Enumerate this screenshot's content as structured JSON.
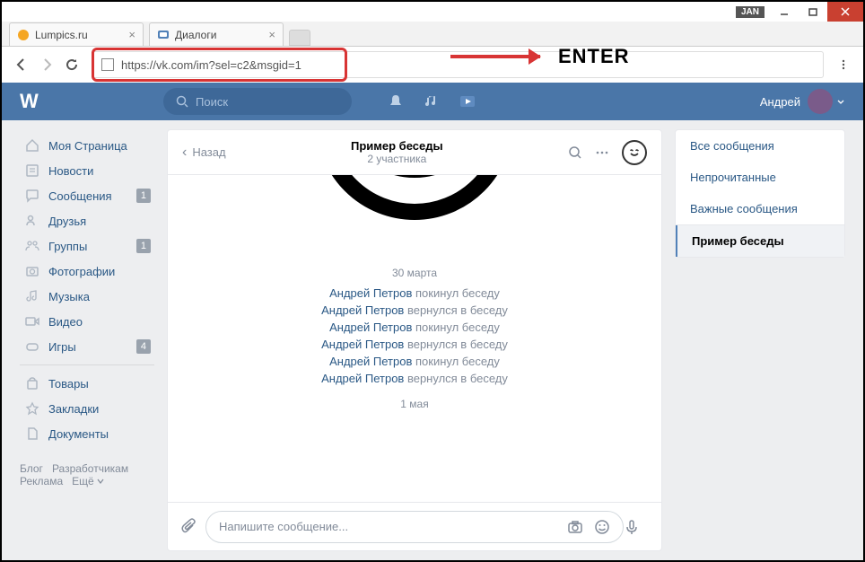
{
  "window": {
    "jan_badge": "JAN"
  },
  "tabs": [
    {
      "title": "Lumpics.ru"
    },
    {
      "title": "Диалоги"
    }
  ],
  "url": "https://vk.com/im?sel=c2&msgid=1",
  "annotation": "ENTER",
  "vk": {
    "search_placeholder": "Поиск",
    "user_name": "Андрей"
  },
  "sidebar": {
    "items": [
      {
        "icon": "home",
        "label": "Моя Страница"
      },
      {
        "icon": "feed",
        "label": "Новости"
      },
      {
        "icon": "msg",
        "label": "Сообщения",
        "badge": "1"
      },
      {
        "icon": "friends",
        "label": "Друзья"
      },
      {
        "icon": "groups",
        "label": "Группы",
        "badge": "1"
      },
      {
        "icon": "photos",
        "label": "Фотографии"
      },
      {
        "icon": "music",
        "label": "Музыка"
      },
      {
        "icon": "video",
        "label": "Видео"
      },
      {
        "icon": "games",
        "label": "Игры",
        "badge": "4"
      }
    ],
    "items2": [
      {
        "icon": "market",
        "label": "Товары"
      },
      {
        "icon": "bookmark",
        "label": "Закладки"
      },
      {
        "icon": "docs",
        "label": "Документы"
      }
    ],
    "footer": {
      "blog": "Блог",
      "dev": "Разработчикам",
      "ads": "Реклама",
      "more": "Ещё"
    }
  },
  "chat": {
    "back": "Назад",
    "title": "Пример беседы",
    "subtitle": "2 участника",
    "date1": "30 марта",
    "messages": [
      {
        "user": "Андрей Петров",
        "action": "покинул беседу"
      },
      {
        "user": "Андрей Петров",
        "action": "вернулся в беседу"
      },
      {
        "user": "Андрей Петров",
        "action": "покинул беседу"
      },
      {
        "user": "Андрей Петров",
        "action": "вернулся в беседу"
      },
      {
        "user": "Андрей Петров",
        "action": "покинул беседу"
      },
      {
        "user": "Андрей Петров",
        "action": "вернулся в беседу"
      }
    ],
    "date2": "1 мая",
    "input_placeholder": "Напишите сообщение..."
  },
  "filters": {
    "all": "Все сообщения",
    "unread": "Непрочитанные",
    "important": "Важные сообщения",
    "active": "Пример беседы"
  }
}
